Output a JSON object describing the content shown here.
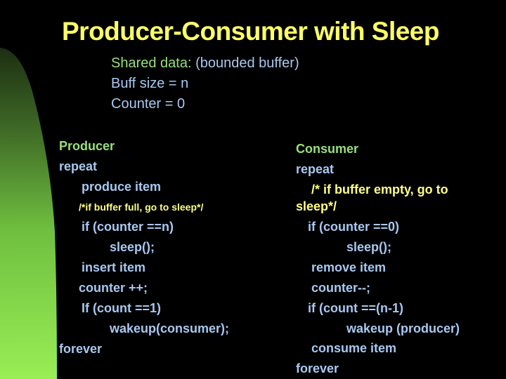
{
  "slide": {
    "title": "Producer-Consumer with Sleep",
    "shared": {
      "label": "Shared data:",
      "label_rest": " (bounded buffer)",
      "lines": [
        "Buff size = n",
        "Counter = 0"
      ]
    },
    "producer": {
      "heading": "Producer",
      "lines": [
        "repeat",
        "produce item",
        "/*if buffer full, go to sleep*/",
        "if (counter ==n)",
        "sleep();",
        "insert item",
        "counter ++;",
        "If (count ==1)",
        "wakeup(consumer);",
        "forever"
      ]
    },
    "consumer": {
      "heading": "Consumer",
      "lines": [
        "repeat",
        "/* if buffer empty, go to",
        "sleep*/",
        "if (counter ==0)",
        "sleep();",
        "remove item",
        "counter--;",
        "if (count ==(n-1)",
        "wakeup (producer)",
        "consume item",
        "forever"
      ]
    },
    "colors": {
      "background": "#000000",
      "title": "#ffff66",
      "heading": "#99e07a",
      "code": "#a8c8f0",
      "comment": "#ffff88",
      "accent_dark": "#2a4a1a",
      "accent_light": "#99ee55"
    }
  }
}
